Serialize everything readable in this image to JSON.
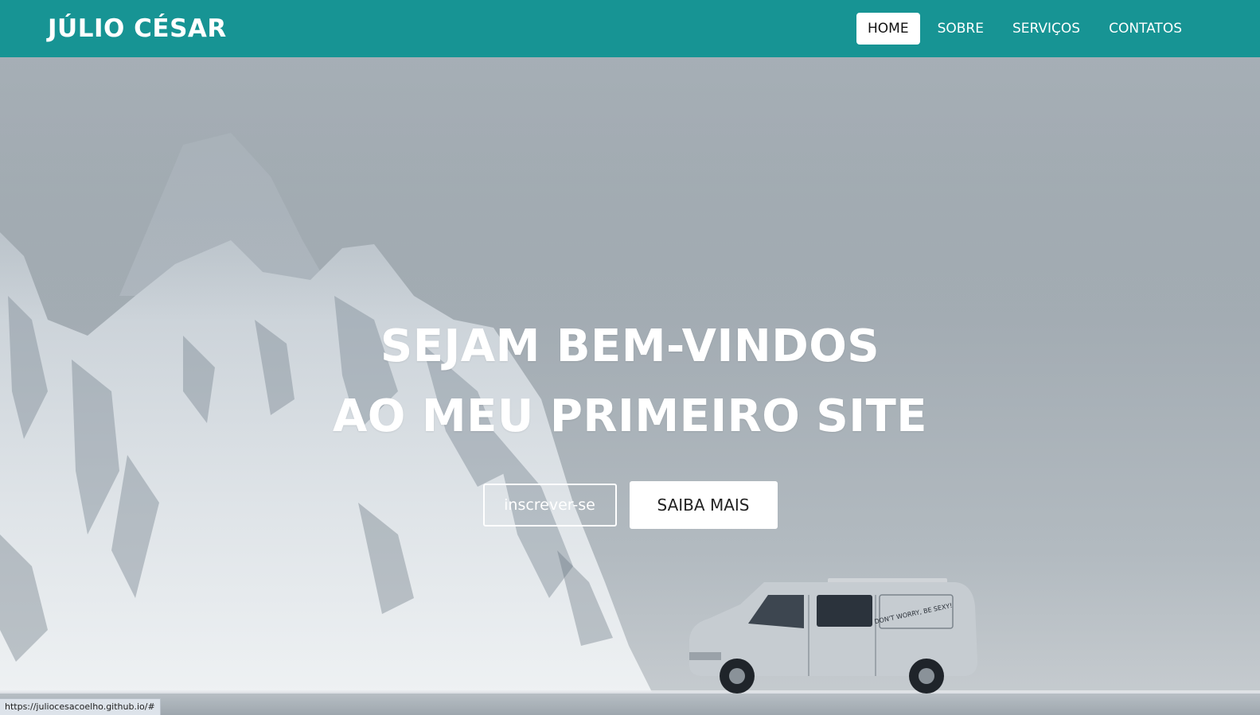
{
  "header": {
    "brand": "JÚLIO CÉSAR",
    "nav": [
      {
        "label": "HOME",
        "active": true
      },
      {
        "label": "SOBRE",
        "active": false
      },
      {
        "label": "SERVIÇOS",
        "active": false
      },
      {
        "label": "CONTATOS",
        "active": false
      }
    ],
    "background_color": "#179494"
  },
  "hero": {
    "title_line1": "SEJAM BEM-VINDOS",
    "title_line2": "AO MEU PRIMEIRO SITE",
    "button_primary": "inscrever-se",
    "button_secondary": "SAIBA MAIS",
    "van_sticker": "DON'T WORRY, BE SEXY!"
  },
  "status_bar": {
    "url": "https://juliocesacoelho.github.io/#"
  }
}
